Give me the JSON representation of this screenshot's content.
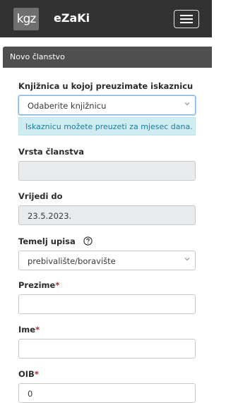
{
  "app": {
    "logo_text": "kgz",
    "brand": "eZaKi"
  },
  "section": {
    "title": "Novo članstvo"
  },
  "form": {
    "library": {
      "label": "Knjižnica u kojoj preuzimate iskaznicu",
      "value": "Odaberite knjižnicu"
    },
    "info": "Iskaznicu možete preuzeti za mjesec dana.",
    "membership_type": {
      "label": "Vrsta članstva",
      "value": ""
    },
    "valid_until": {
      "label": "Vrijedi do",
      "value": "23.5.2023."
    },
    "enrollment_basis": {
      "label": "Temelj upisa",
      "value": "prebivalište/boravište"
    },
    "surname": {
      "label": "Prezime",
      "value": ""
    },
    "name": {
      "label": "Ime",
      "value": ""
    },
    "oib": {
      "label": "OIB",
      "value": "0"
    },
    "required_mark": "*"
  },
  "icons": {
    "toggle": "hamburger-menu-icon",
    "help": "question-circle-icon",
    "dropdown": "chevron-down-icon"
  },
  "colors": {
    "topbar": "#323232",
    "header": "#4f4f4f",
    "required": "#b02a37",
    "info_bg": "#d1ecf1"
  }
}
